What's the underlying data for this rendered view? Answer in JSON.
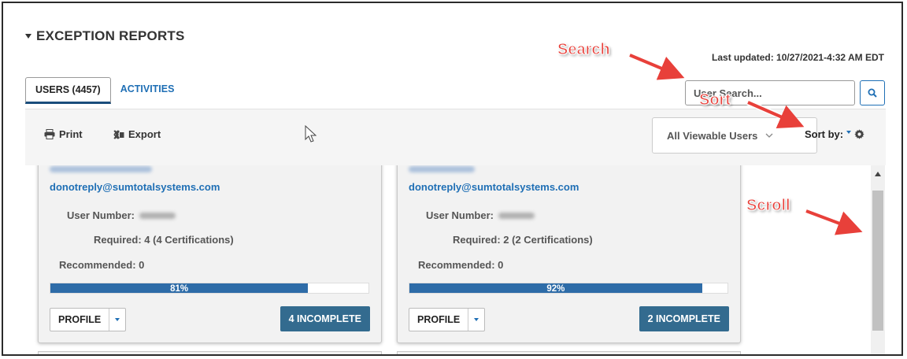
{
  "section": {
    "title": "EXCEPTION REPORTS"
  },
  "header": {
    "last_updated": "Last updated: 10/27/2021-4:32 AM EDT"
  },
  "tabs": [
    {
      "label": "USERS (4457)",
      "active": true
    },
    {
      "label": "ACTIVITIES",
      "active": false
    }
  ],
  "search": {
    "placeholder": "User Search...",
    "button_icon": "search-icon"
  },
  "toolbar": {
    "print_label": "Print",
    "print_icon": "printer-icon",
    "export_label": "Export",
    "export_icon": "excel-icon",
    "view_filter": "All Viewable Users",
    "sort_label": "Sort by:",
    "sort_icon": "gear-icon"
  },
  "cards": [
    {
      "email": "donotreply@sumtotalsystems.com",
      "user_number_label": "User Number:",
      "required": "Required: 4 (4 Certifications)",
      "recommended": "Recommended: 0",
      "progress": 81,
      "progress_text": "81%",
      "profile_label": "PROFILE",
      "incomplete_label": "4 INCOMPLETE"
    },
    {
      "email": "donotreply@sumtotalsystems.com",
      "user_number_label": "User Number:",
      "required": "Required: 2 (2 Certifications)",
      "recommended": "Recommended: 0",
      "progress": 92,
      "progress_text": "92%",
      "profile_label": "PROFILE",
      "incomplete_label": "2 INCOMPLETE"
    }
  ],
  "annotations": {
    "search": "Search",
    "sort": "Sort",
    "scroll": "Scroll"
  },
  "colors": {
    "accent": "#1f6fb5",
    "progress": "#2e6ca8",
    "incomplete_button": "#336b8f",
    "annotation": "#e8403a"
  }
}
